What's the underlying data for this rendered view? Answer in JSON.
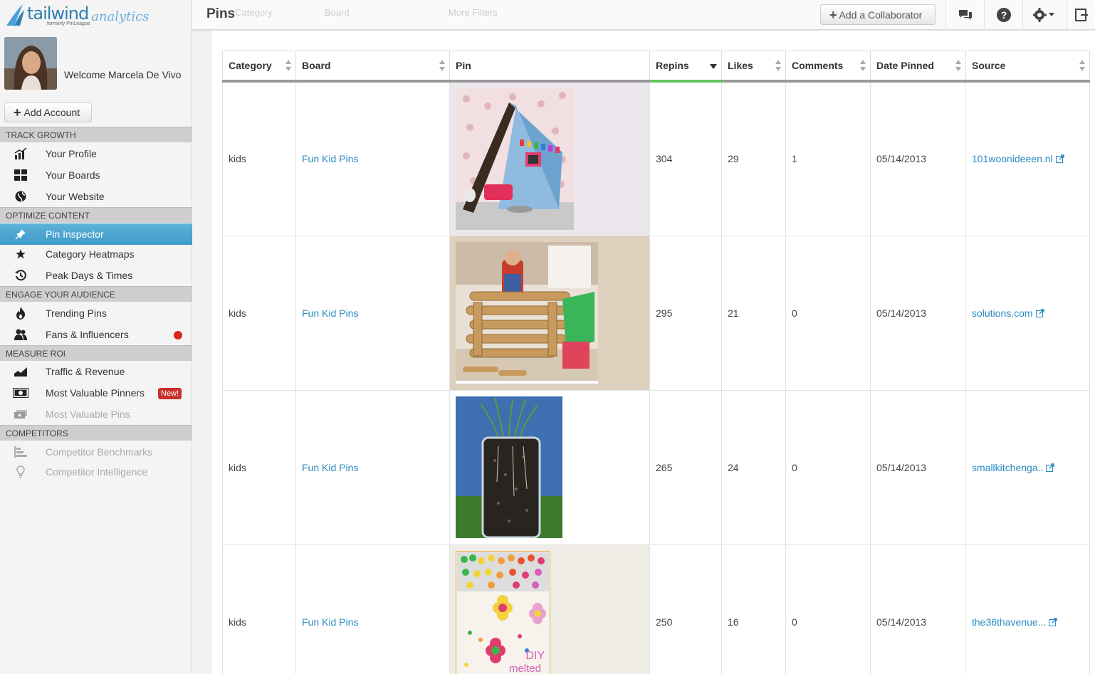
{
  "app": {
    "logo_word": "tailwind",
    "logo_sub": "analytics",
    "logo_formerly": "formerly PinLeague"
  },
  "user": {
    "welcome": "Welcome Marcela De Vivo",
    "add_account_label": "Add Account"
  },
  "nav": {
    "sections": {
      "track_growth": "TRACK GROWTH",
      "optimize_content": "OPTIMIZE CONTENT",
      "engage_audience": "ENGAGE YOUR AUDIENCE",
      "measure_roi": "MEASURE ROI",
      "competitors": "COMPETITORS"
    },
    "items": {
      "your_profile": "Your Profile",
      "your_boards": "Your Boards",
      "your_website": "Your Website",
      "pin_inspector": "Pin Inspector",
      "category_heatmaps": "Category Heatmaps",
      "peak_days_times": "Peak Days & Times",
      "trending_pins": "Trending Pins",
      "fans_influencers": "Fans & Influencers",
      "traffic_revenue": "Traffic & Revenue",
      "most_valuable_pinners": "Most Valuable Pinners",
      "most_valuable_pins": "Most Valuable Pins",
      "competitor_benchmarks": "Competitor Benchmarks",
      "competitor_intelligence": "Competitor Intelligence"
    },
    "new_badge": "New!"
  },
  "topbar": {
    "title": "Pins",
    "ghost_category": "Category",
    "ghost_board": "Board",
    "ghost_filters": "More Filters",
    "add_collaborator": "Add a Collaborator"
  },
  "table": {
    "headers": {
      "category": "Category",
      "board": "Board",
      "pin": "Pin",
      "repins": "Repins",
      "likes": "Likes",
      "comments": "Comments",
      "date_pinned": "Date Pinned",
      "source": "Source"
    },
    "rows": [
      {
        "category": "kids",
        "board": "Fun Kid Pins",
        "repins": "304",
        "likes": "29",
        "comments": "1",
        "date": "05/14/2013",
        "source": "101woonideeen.nl"
      },
      {
        "category": "kids",
        "board": "Fun Kid Pins",
        "repins": "295",
        "likes": "21",
        "comments": "0",
        "date": "05/14/2013",
        "source": "solutions.com"
      },
      {
        "category": "kids",
        "board": "Fun Kid Pins",
        "repins": "265",
        "likes": "24",
        "comments": "0",
        "date": "05/14/2013",
        "source": "smallkitchenga.."
      },
      {
        "category": "kids",
        "board": "Fun Kid Pins",
        "repins": "250",
        "likes": "16",
        "comments": "0",
        "date": "05/14/2013",
        "source": "the36thavenue..."
      }
    ],
    "pin_text_row4": {
      "line1": "DIY",
      "line2": "melted"
    }
  },
  "colors": {
    "accent": "#2a8bc2",
    "active_nav": "#4aa5d0",
    "sorted_header": "#62c462",
    "new_badge": "#c9302c"
  }
}
